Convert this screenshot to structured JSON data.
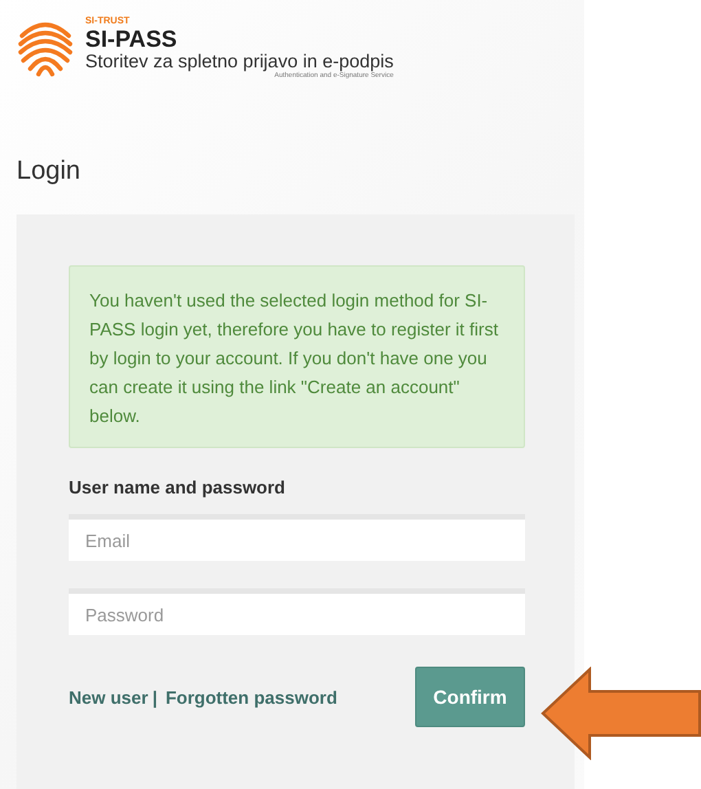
{
  "header": {
    "brand_small": "SI-TRUST",
    "brand": "SI-PASS",
    "subtitle": "Storitev za spletno prijavo in e-podpis",
    "tagline": "Authentication and e-Signature Service"
  },
  "page_title": "Login",
  "notice": "You haven't used the selected login method for SI-PASS login yet, therefore you have to register it first by login to your account. If you don't have one you can create it using the link \"Create an account\" below.",
  "section_label": "User name and password",
  "fields": [
    {
      "placeholder": "Email"
    },
    {
      "placeholder": "Password"
    }
  ],
  "links": [
    "New user",
    "Forgotten password"
  ],
  "separator": "|",
  "confirm_button": "Confirm"
}
